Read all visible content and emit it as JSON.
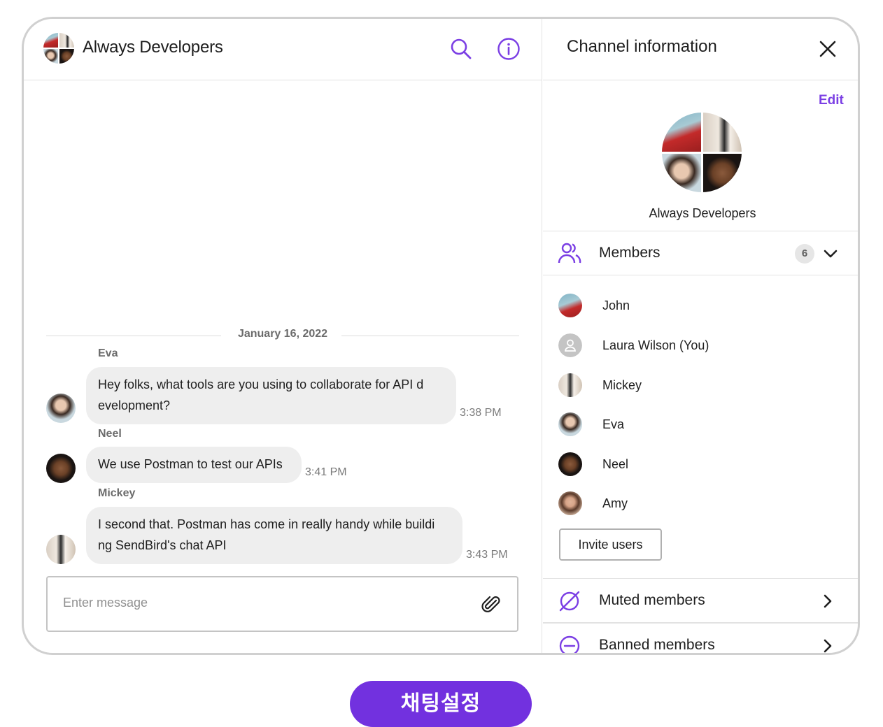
{
  "chat": {
    "title": "Always Developers",
    "date_separator": "January 16, 2022",
    "messages": [
      {
        "sender": "Eva",
        "text_line1": "Hey folks, what tools are you using to collaborate for API d",
        "text_line2": "evelopment?",
        "time": "3:38 PM"
      },
      {
        "sender": "Neel",
        "text_line1": "We use Postman to test our APIs",
        "time": "3:41 PM"
      },
      {
        "sender": "Mickey",
        "text_line1": "I second that. Postman has come in really handy while buildi",
        "text_line2": "ng SendBird's chat API",
        "time": "3:43 PM"
      }
    ],
    "composer_placeholder": "Enter message"
  },
  "info": {
    "title": "Channel information",
    "edit_label": "Edit",
    "channel_name": "Always Developers",
    "members_label": "Members",
    "members_count": "6",
    "members": [
      {
        "name": "John"
      },
      {
        "name": "Laura Wilson (You)"
      },
      {
        "name": "Mickey"
      },
      {
        "name": "Eva"
      },
      {
        "name": "Neel"
      },
      {
        "name": "Amy"
      }
    ],
    "invite_label": "Invite users",
    "muted_label": "Muted members",
    "banned_label": "Banned members"
  },
  "cta_label": "채팅설정",
  "colors": {
    "accent": "#7b3fe4",
    "cta_bg": "#7231df",
    "bubble_bg": "#eeeeee"
  },
  "icons": [
    "search-icon",
    "info-icon",
    "close-icon",
    "members-icon",
    "chevron-down-icon",
    "muted-icon",
    "banned-icon",
    "chevron-right-icon",
    "attach-icon"
  ]
}
